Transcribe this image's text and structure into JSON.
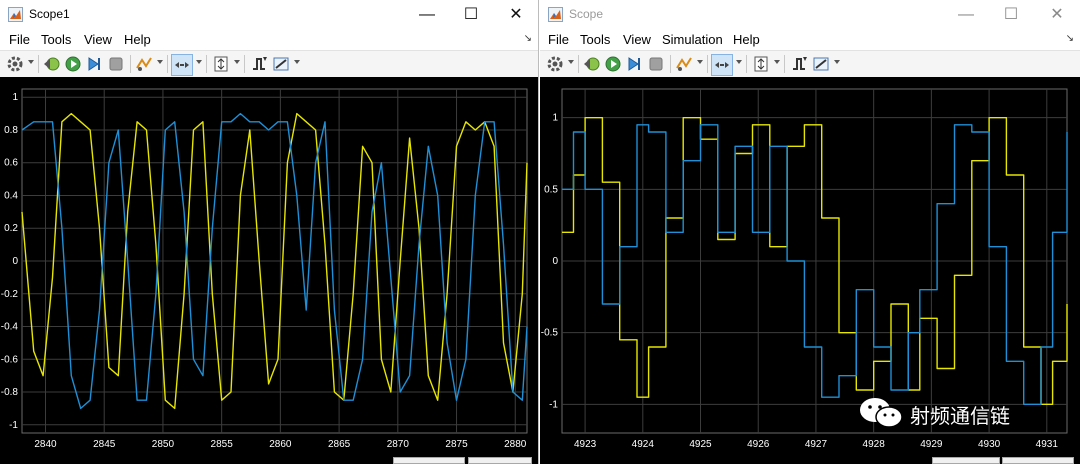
{
  "windows": [
    {
      "title": "Scope1",
      "menu": [
        "File",
        "Tools",
        "View",
        "Help"
      ],
      "toolbar_icons": [
        "settings-icon",
        "step-back-icon",
        "run-icon",
        "step-forward-icon",
        "stop-icon",
        "highlight-signal-icon",
        "zoom-icon",
        "autoscale-icon",
        "triggers-icon",
        "cursor-measurements-icon"
      ]
    },
    {
      "title": "Scope",
      "menu": [
        "File",
        "Tools",
        "View",
        "Simulation",
        "Help"
      ],
      "toolbar_icons": [
        "settings-icon",
        "step-back-icon",
        "run-icon",
        "step-forward-icon",
        "stop-icon",
        "highlight-signal-icon",
        "zoom-icon",
        "autoscale-icon",
        "triggers-icon",
        "cursor-measurements-icon"
      ]
    }
  ],
  "watermark": {
    "text": "射频通信链"
  },
  "colors": {
    "plot_background": "#000000",
    "grid": "#3d3d3d",
    "axis_text": "#ffffff",
    "series_yellow": "#e6e600",
    "series_blue": "#1f8fd6"
  },
  "chart_data": [
    {
      "type": "line",
      "xlim": [
        2838,
        2881
      ],
      "ylim": [
        -1.05,
        1.05
      ],
      "x_ticks": [
        2840,
        2845,
        2850,
        2855,
        2860,
        2865,
        2870,
        2875,
        2880
      ],
      "y_ticks": [
        -1,
        -0.8,
        -0.6,
        -0.4,
        -0.2,
        0,
        0.2,
        0.4,
        0.6,
        0.8,
        1
      ],
      "y_tick_labels": [
        "-1",
        "-0.8",
        "-0.6",
        "-0.4",
        "-0.2",
        "0",
        "0.2",
        "0.4",
        "0.6",
        "0.8",
        "1"
      ],
      "grid": true,
      "series": [
        {
          "color": "#e6e600",
          "x": [
            2838,
            2839,
            2839.8,
            2840.6,
            2841.4,
            2842.2,
            2843.0,
            2843.8,
            2844.6,
            2845.4,
            2846.2,
            2847.0,
            2847.8,
            2848.6,
            2849.4,
            2850.2,
            2851.0,
            2851.8,
            2852.6,
            2853.4,
            2854.2,
            2855.0,
            2855.8,
            2856.6,
            2857.4,
            2858.2,
            2859.0,
            2859.8,
            2860.6,
            2861.4,
            2862.2,
            2863.0,
            2863.8,
            2864.6,
            2865.4,
            2866.2,
            2867.0,
            2867.8,
            2868.6,
            2869.4,
            2870.2,
            2871.0,
            2871.8,
            2872.6,
            2873.4,
            2874.2,
            2875.0,
            2875.8,
            2876.6,
            2877.4,
            2878.2,
            2879.0,
            2879.8,
            2880.6,
            2881
          ],
          "y": [
            0.3,
            -0.55,
            -0.7,
            -0.1,
            0.85,
            0.9,
            0.85,
            0.8,
            0.2,
            -0.65,
            -0.7,
            0.3,
            0.85,
            0.8,
            0.1,
            -0.85,
            -0.9,
            -0.2,
            0.8,
            0.85,
            -0.2,
            -0.85,
            -0.8,
            0.4,
            0.8,
            0.0,
            -0.75,
            -0.6,
            0.6,
            0.9,
            0.85,
            0.8,
            0.1,
            -0.8,
            -0.85,
            -0.2,
            0.7,
            0.6,
            -0.6,
            -0.8,
            0.0,
            0.75,
            0.2,
            -0.7,
            -0.85,
            -0.2,
            0.7,
            0.85,
            0.8,
            0.85,
            0.7,
            -0.5,
            -0.8,
            -0.2,
            0.6
          ]
        },
        {
          "color": "#1f8fd6",
          "x": [
            2838,
            2839,
            2839.8,
            2840.6,
            2841.4,
            2842.2,
            2843.0,
            2843.8,
            2844.6,
            2845.4,
            2846.2,
            2847.0,
            2847.8,
            2848.6,
            2849.4,
            2850.2,
            2851.0,
            2851.8,
            2852.6,
            2853.4,
            2854.2,
            2855.0,
            2855.8,
            2856.6,
            2857.4,
            2858.2,
            2859.0,
            2859.8,
            2860.6,
            2861.4,
            2862.2,
            2863.0,
            2863.8,
            2864.6,
            2865.4,
            2866.2,
            2867.0,
            2867.8,
            2868.6,
            2869.4,
            2870.2,
            2871.0,
            2871.8,
            2872.6,
            2873.4,
            2874.2,
            2875.0,
            2875.8,
            2876.6,
            2877.4,
            2878.2,
            2879.0,
            2879.8,
            2880.6,
            2881
          ],
          "y": [
            0.8,
            0.85,
            0.85,
            0.85,
            0.2,
            -0.7,
            -0.9,
            -0.85,
            -0.3,
            0.6,
            0.8,
            0.0,
            -0.85,
            -0.85,
            -0.2,
            0.8,
            0.85,
            0.3,
            -0.6,
            -0.7,
            0.2,
            0.85,
            0.85,
            0.9,
            0.85,
            0.85,
            0.8,
            0.85,
            0.85,
            0.4,
            -0.3,
            0.6,
            0.85,
            -0.3,
            -0.85,
            -0.85,
            -0.6,
            0.3,
            0.6,
            -0.1,
            -0.8,
            -0.7,
            0.1,
            0.7,
            0.4,
            -0.5,
            -0.85,
            -0.6,
            0.4,
            0.85,
            0.85,
            0.1,
            -0.8,
            -0.85,
            -0.4
          ]
        }
      ]
    },
    {
      "type": "line",
      "xlim": [
        4922.6,
        4931.35
      ],
      "ylim": [
        -1.2,
        1.2
      ],
      "x_ticks": [
        4923,
        4924,
        4925,
        4926,
        4927,
        4928,
        4929,
        4930,
        4931
      ],
      "y_ticks": [
        -1,
        -0.5,
        0,
        0.5,
        1
      ],
      "y_tick_labels": [
        "-1",
        "-0.5",
        "0",
        "0.5",
        "1"
      ],
      "grid": true,
      "series": [
        {
          "color": "#e6e600",
          "x": [
            4922.6,
            4922.8,
            4923.0,
            4923.3,
            4923.6,
            4923.9,
            4924.1,
            4924.4,
            4924.7,
            4925.0,
            4925.3,
            4925.6,
            4925.9,
            4926.2,
            4926.5,
            4926.8,
            4927.1,
            4927.4,
            4927.7,
            4928.0,
            4928.3,
            4928.6,
            4928.8,
            4929.1,
            4929.4,
            4929.7,
            4930.0,
            4930.3,
            4930.6,
            4930.9,
            4931.1,
            4931.35
          ],
          "y": [
            0.2,
            0.6,
            1.0,
            0.55,
            -0.55,
            -0.95,
            -0.6,
            0.3,
            1.0,
            0.85,
            0.15,
            0.75,
            0.95,
            0.1,
            0.8,
            0.95,
            0.3,
            -0.5,
            -0.9,
            -0.7,
            -0.3,
            -0.9,
            -0.4,
            -0.75,
            -0.1,
            0.7,
            1.0,
            0.6,
            -0.6,
            -1.0,
            -0.7,
            -0.3
          ]
        },
        {
          "color": "#1f8fd6",
          "x": [
            4922.6,
            4922.8,
            4923.0,
            4923.3,
            4923.6,
            4923.9,
            4924.1,
            4924.4,
            4924.7,
            4925.0,
            4925.3,
            4925.6,
            4925.9,
            4926.2,
            4926.5,
            4926.8,
            4927.1,
            4927.4,
            4927.7,
            4928.0,
            4928.3,
            4928.6,
            4928.8,
            4929.1,
            4929.4,
            4929.7,
            4930.0,
            4930.3,
            4930.6,
            4930.9,
            4931.1,
            4931.35
          ],
          "y": [
            0.5,
            0.9,
            0.5,
            -0.3,
            0.1,
            0.95,
            0.9,
            0.2,
            0.7,
            0.95,
            0.2,
            0.8,
            0.2,
            0.8,
            0.0,
            -0.6,
            -0.95,
            -0.8,
            -0.2,
            -0.6,
            -0.9,
            -0.5,
            -0.2,
            0.4,
            0.95,
            0.9,
            0.1,
            -0.7,
            -1.0,
            -0.6,
            0.2,
            0.9
          ]
        }
      ]
    }
  ]
}
